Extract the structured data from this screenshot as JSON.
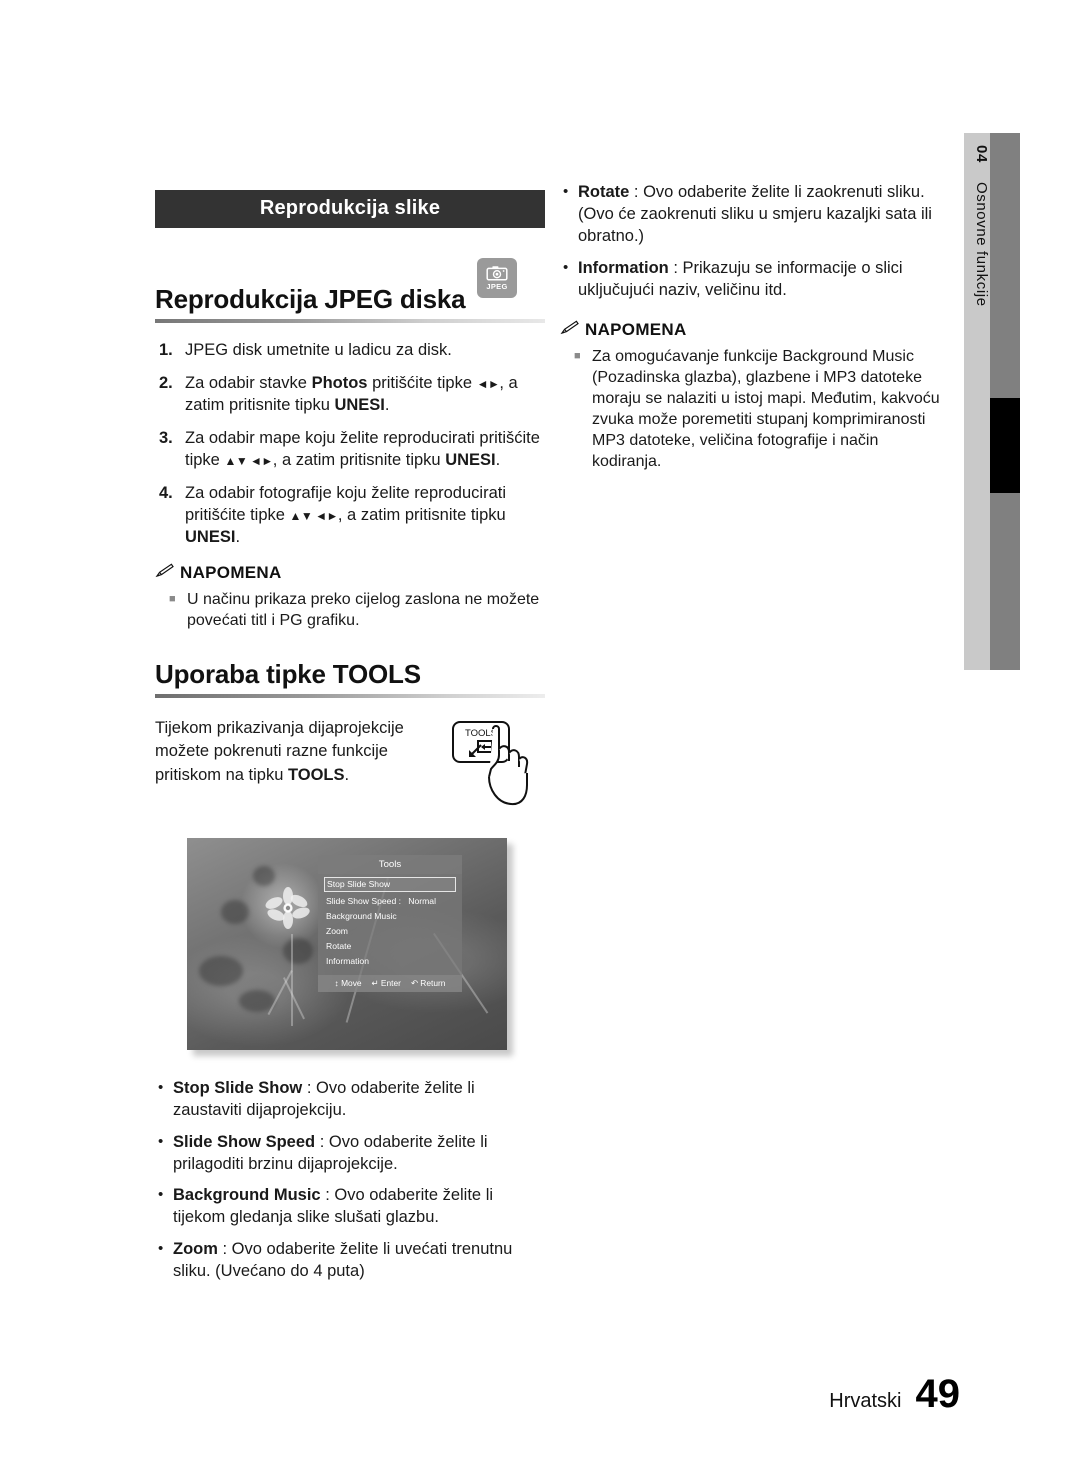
{
  "chapter_tab": {
    "number": "04",
    "title": "Osnovne funkcije"
  },
  "section_band": {
    "label": "Reprodukcija slike"
  },
  "media_badge": {
    "icon": "camera-icon",
    "label": "JPEG",
    "bg": "#9a9a9a"
  },
  "headings": {
    "jpeg_playback": "Reprodukcija JPEG diska",
    "tools_usage": "Uporaba tipke TOOLS"
  },
  "steps": [
    {
      "num": "1.",
      "parts": [
        {
          "t": "JPEG disk umetnite u ladicu za disk."
        }
      ]
    },
    {
      "num": "2.",
      "parts": [
        {
          "t": "Za odabir stavke "
        },
        {
          "t": "Photos",
          "b": true
        },
        {
          "t": " pritišćite tipke "
        },
        {
          "t": "◄►",
          "arrows": true
        },
        {
          "t": ", a zatim pritisnite tipku "
        },
        {
          "t": "UNESI",
          "b": true
        },
        {
          "t": "."
        }
      ]
    },
    {
      "num": "3.",
      "parts": [
        {
          "t": "Za odabir mape koju želite reproducirati pritišćite tipke "
        },
        {
          "t": "▲▼ ◄►",
          "arrows": true
        },
        {
          "t": ", a zatim pritisnite tipku "
        },
        {
          "t": "UNESI",
          "b": true
        },
        {
          "t": "."
        }
      ]
    },
    {
      "num": "4.",
      "parts": [
        {
          "t": "Za odabir fotografije koju želite reproducirati pritišćite tipke "
        },
        {
          "t": "▲▼ ◄►",
          "arrows": true
        },
        {
          "t": ", a zatim pritisnite tipku "
        },
        {
          "t": "UNESI",
          "b": true
        },
        {
          "t": "."
        }
      ]
    }
  ],
  "note_left": {
    "title": "NAPOMENA",
    "icon": "pencil-icon",
    "items": [
      "U načinu prikaza preko cijelog zaslona ne možete povećati titl i PG grafiku."
    ]
  },
  "tools_intro": {
    "text_parts": [
      {
        "t": "Tijekom prikazivanja dijaprojekcije možete pokrenuti razne funkcije pritiskom na tipku "
      },
      {
        "t": "TOOLS",
        "b": true
      },
      {
        "t": "."
      }
    ],
    "illustration": {
      "button_label": "TOOLS",
      "icon": "hand-pressing-tools-button-icon"
    }
  },
  "tools_screenshot": {
    "menu_title": "Tools",
    "rows": [
      {
        "label": "Stop Slide Show",
        "value": "",
        "selected": true
      },
      {
        "label": "Slide Show Speed :",
        "value": "Normal",
        "selected": false
      },
      {
        "label": "Background Music",
        "value": "",
        "selected": false
      },
      {
        "label": "Zoom",
        "value": "",
        "selected": false
      },
      {
        "label": "Rotate",
        "value": "",
        "selected": false
      },
      {
        "label": "Information",
        "value": "",
        "selected": false
      }
    ],
    "footer_hints": [
      {
        "icon": "updown-arrow-icon",
        "glyph": "↕",
        "label": "Move"
      },
      {
        "icon": "enter-key-icon",
        "glyph": "↵",
        "label": "Enter"
      },
      {
        "icon": "return-arrow-icon",
        "glyph": "↶",
        "label": "Return"
      }
    ]
  },
  "option_bullets": [
    {
      "term": "Stop Slide Show",
      "sep": " : ",
      "desc": "Ovo odaberite želite li zaustaviti dijaprojekciju."
    },
    {
      "term": "Slide Show Speed",
      "sep": " : ",
      "desc": "Ovo odaberite želite li prilagoditi brzinu dijaprojekcije."
    },
    {
      "term": "Background Music",
      "sep": " : ",
      "desc": "Ovo odaberite želite li tijekom gledanja slike slušati glazbu."
    },
    {
      "term": "Zoom",
      "sep": " : ",
      "desc": "Ovo odaberite želite li uvećati trenutnu sliku. (Uvećano do 4 puta)"
    }
  ],
  "right_bullets": [
    {
      "term": "Rotate",
      "sep": " : ",
      "desc": "Ovo odaberite želite li zaokrenuti sliku. (Ovo će zaokrenuti sliku u smjeru kazaljki sata ili obratno.)"
    },
    {
      "term": "Information",
      "sep": " : ",
      "desc": "Prikazuju se informacije o slici uključujući naziv, veličinu itd."
    }
  ],
  "note_right": {
    "title": "NAPOMENA",
    "icon": "pencil-icon",
    "items": [
      "Za omogućavanje funkcije Background Music (Pozadinska glazba), glazbene i MP3 datoteke moraju se nalaziti u istoj mapi. Međutim, kakvoću zvuka može poremetiti stupanj komprimiranosti MP3 datoteke, veličina fotografije i način kodiranja."
    ]
  },
  "footer": {
    "language": "Hrvatski",
    "page": "49"
  }
}
